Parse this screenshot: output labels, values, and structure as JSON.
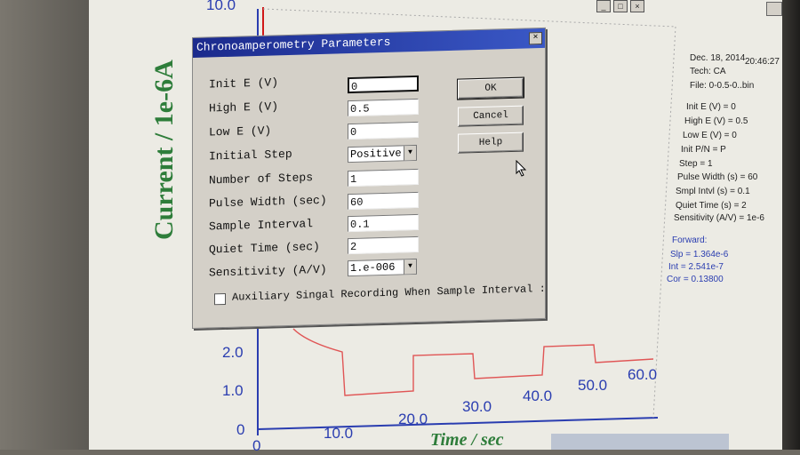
{
  "plot": {
    "ylabel": "Current / 1e-6A",
    "xlabel": "Time / sec",
    "top_ytick": "10.0",
    "yticks": [
      "2.0",
      "1.0",
      "0"
    ],
    "xticks": [
      "0",
      "10.0",
      "20.0",
      "30.0",
      "40.0",
      "50.0",
      "60.0"
    ]
  },
  "info": {
    "date": "Dec. 18, 2014",
    "time": "20:46:27",
    "tech": "Tech: CA",
    "file": "File: 0-0.5-0..bin",
    "params": [
      "Init E (V) = 0",
      "High E (V) = 0.5",
      "Low E (V) = 0",
      "Init P/N = P",
      "Step = 1",
      "Pulse Width (s) = 60",
      "Smpl Intvl (s) = 0.1",
      "Quiet Time (s) = 2",
      "Sensitivity (A/V) = 1e-6"
    ],
    "forward_title": "Forward:",
    "forward": [
      "Slp = 1.364e-6",
      "Int = 2.541e-7",
      "Cor = 0.13800"
    ]
  },
  "dialog": {
    "title": "Chronoamperometry Parameters",
    "close": "×",
    "labels": {
      "init_e": "Init E (V)",
      "high_e": "High E (V)",
      "low_e": "Low E (V)",
      "initial_step": "Initial Step",
      "num_steps": "Number of Steps",
      "pulse_width": "Pulse Width (sec)",
      "sample_interval": "Sample Interval",
      "quiet_time": "Quiet Time (sec)",
      "sensitivity": "Sensitivity (A/V)"
    },
    "values": {
      "init_e": "0",
      "high_e": "0.5",
      "low_e": "0",
      "initial_step": "Positive",
      "num_steps": "1",
      "pulse_width": "60",
      "sample_interval": "0.1",
      "quiet_time": "2",
      "sensitivity": "1.e-006"
    },
    "buttons": {
      "ok": "OK",
      "cancel": "Cancel",
      "help": "Help"
    },
    "aux_checkbox": "Auxiliary Singal Recording When Sample Interval :"
  }
}
